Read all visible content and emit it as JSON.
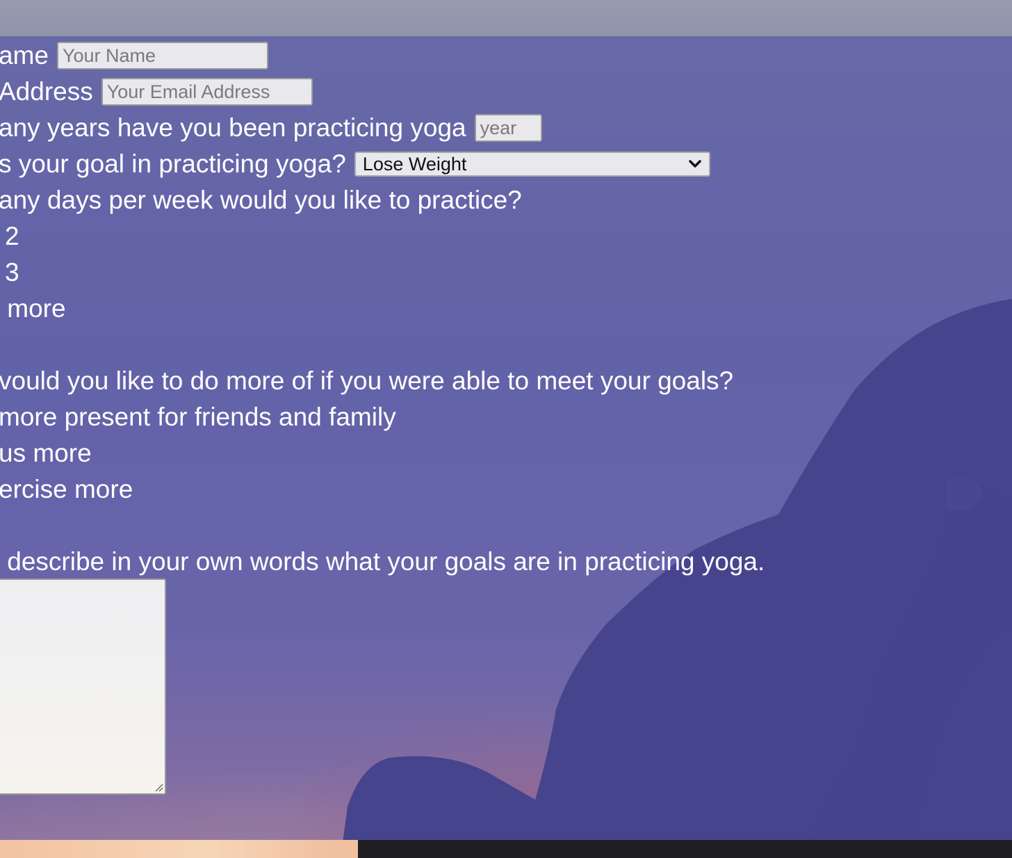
{
  "form": {
    "name": {
      "label": "ame",
      "placeholder": "Your Name"
    },
    "email": {
      "label": "Address",
      "placeholder": "Your Email Address"
    },
    "years": {
      "label": "any years have you been practicing yoga",
      "placeholder": "year"
    },
    "goal": {
      "label": "s your goal in practicing yoga?",
      "selected": "Lose Weight"
    },
    "days": {
      "question": "any days per week would you like to practice?",
      "options": [
        "2",
        "3",
        " more"
      ]
    },
    "more_of": {
      "question": "vould you like to do more of if you were able to meet your goals?",
      "options": [
        "more present for friends and family",
        "us more",
        "ercise more"
      ]
    },
    "describe": {
      "label": " describe in your own words what your goals are in practicing yoga."
    }
  },
  "icons": {
    "select_arrow": "chevron-down-icon",
    "resize_handle": "resize-grip-icon"
  },
  "colors": {
    "overlay": "#4e4ca0",
    "text": "#ffffff",
    "input_bg": "#e9e9ed",
    "silhouette": "#3d3b72"
  }
}
